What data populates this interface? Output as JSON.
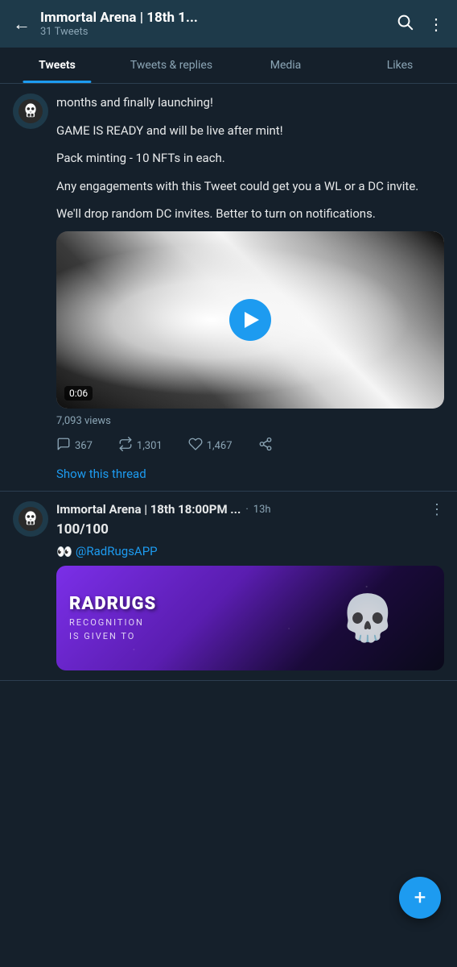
{
  "header": {
    "title": "Immortal Arena | 18th 1...",
    "subtitle": "31 Tweets",
    "back_label": "←",
    "search_icon": "search",
    "more_icon": "⋮"
  },
  "tabs": [
    {
      "label": "Tweets",
      "active": true
    },
    {
      "label": "Tweets & replies",
      "active": false
    },
    {
      "label": "Media",
      "active": false
    },
    {
      "label": "Likes",
      "active": false
    }
  ],
  "tweet1": {
    "avatar_alt": "skull avatar",
    "content_lines": [
      "months and finally launching!",
      "GAME IS READY and will be live after mint!",
      "Pack minting - 10 NFTs in each.",
      "Any engagements with this Tweet could get you a WL or a DC invite.",
      "We'll drop random DC invites. Better to turn on notifications."
    ],
    "video": {
      "duration": "0:06"
    },
    "views": "7,093 views",
    "actions": {
      "reply_count": "367",
      "retweet_count": "1,301",
      "like_count": "1,467"
    },
    "show_thread": "Show this thread"
  },
  "tweet2": {
    "author": "Immortal Arena | 18th 18:00PM ...",
    "time": "13h",
    "more_icon": "⋮",
    "content": "100/100",
    "mention_eyes": "👀",
    "mention": "@RadRugsAPP",
    "banner": {
      "title": "RADRUGS",
      "subtitle": "RECOGNITION",
      "line3": "IS GIVEN TO"
    }
  },
  "fab": {
    "label": "+"
  }
}
